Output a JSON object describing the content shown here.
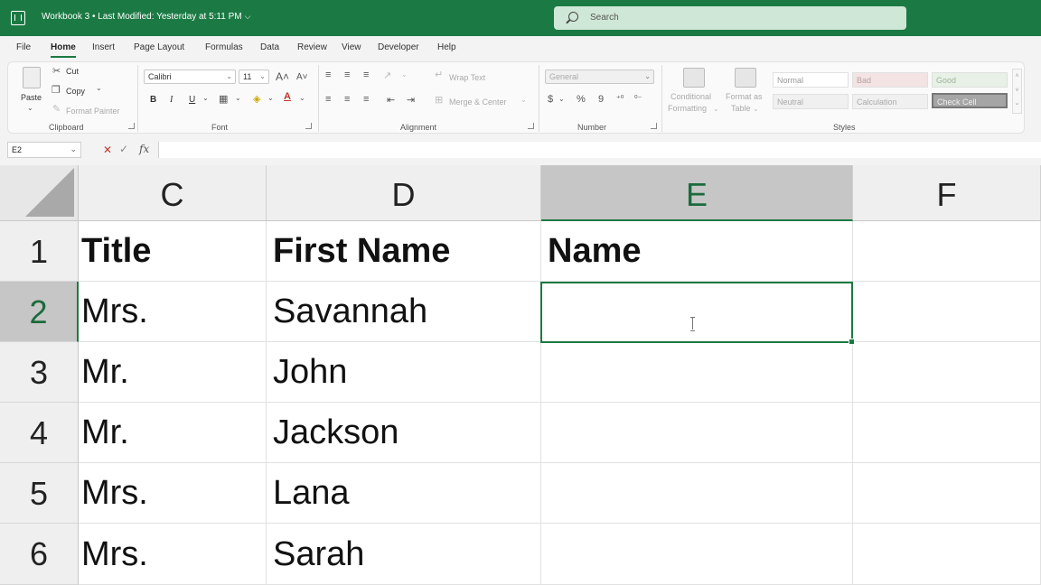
{
  "window": {
    "title": "Workbook 3 • Last Modified: Yesterday at 5:11 PM",
    "title_chevron": "⌵",
    "search_placeholder": "Search",
    "accent": "#1b7a43"
  },
  "menu": {
    "items": [
      "File",
      "Home",
      "Insert",
      "Page Layout",
      "Formulas",
      "Data",
      "Review",
      "View",
      "Developer",
      "Help"
    ],
    "active": "Home"
  },
  "ribbon": {
    "clipboard": {
      "label": "Clipboard",
      "paste": "Paste",
      "cut": "Cut",
      "copy": "Copy",
      "format_painter": "Format Painter"
    },
    "font": {
      "label": "Font",
      "name": "Calibri",
      "size": "11",
      "bold": "B",
      "italic": "I",
      "underline": "U"
    },
    "alignment": {
      "label": "Alignment",
      "wrap_text": "Wrap Text",
      "merge_center": "Merge & Center"
    },
    "number": {
      "label": "Number",
      "format": "General"
    },
    "conditional": {
      "line1": "Conditional",
      "line2": "Formatting"
    },
    "format_table": {
      "line1": "Format as",
      "line2": "Table"
    },
    "styles": {
      "label": "Styles",
      "cells": [
        "Normal",
        "Bad",
        "Good",
        "Neutral",
        "Calculation",
        "Check Cell"
      ]
    }
  },
  "formula_bar": {
    "name_box": "E2",
    "cancel": "✕",
    "enter": "✓",
    "fx": "fx",
    "value": ""
  },
  "sheet": {
    "columns": [
      "C",
      "D",
      "E",
      "F"
    ],
    "selected_column": "E",
    "rows": [
      "1",
      "2",
      "3",
      "4",
      "5",
      "6"
    ],
    "selected_row": "2",
    "active_cell": "E2",
    "cells": [
      [
        "Title",
        "First Name",
        "Name",
        ""
      ],
      [
        "Mrs.",
        "Savannah",
        "",
        ""
      ],
      [
        "Mr.",
        "John",
        "",
        ""
      ],
      [
        "Mr.",
        "Jackson",
        "",
        ""
      ],
      [
        "Mrs.",
        "Lana",
        "",
        ""
      ],
      [
        "Mrs.",
        "Sarah",
        "",
        ""
      ]
    ]
  }
}
